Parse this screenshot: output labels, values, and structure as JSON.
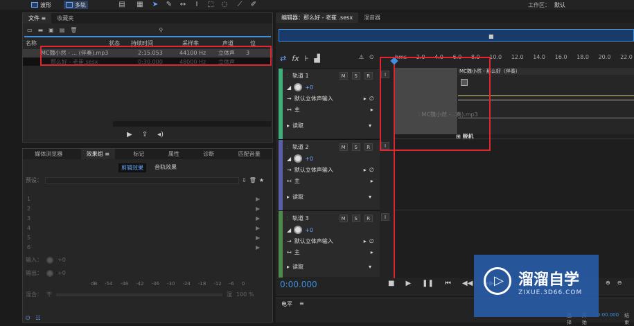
{
  "topbar": {
    "waveform_label": "波形",
    "multitrack_label": "多轨",
    "workspace_label": "工作区：",
    "workspace_value": "默认"
  },
  "files_panel": {
    "tabs": [
      "文件",
      "收藏夹"
    ],
    "columns": [
      "名称",
      "状态",
      "持续时间",
      "采样率",
      "声道",
      "位"
    ],
    "rows": [
      {
        "name": "MC魏小然 - ... (伴奏).mp3",
        "duration": "2:15.053",
        "rate": "44100 Hz",
        "channels": "立体声",
        "bits": "3"
      },
      {
        "name": "那么好 - 老崔.sesx",
        "duration": "0:30.000",
        "rate": "48000 Hz",
        "channels": "立体声",
        "bits": ""
      }
    ]
  },
  "effects_panel": {
    "tabs": [
      "媒体浏览器",
      "效果组",
      "标记",
      "属性",
      "诊断",
      "匹配音量"
    ],
    "subtabs": [
      "剪辑效果",
      "音轨效果"
    ],
    "preset_label": "预设：",
    "slots": [
      "1",
      "2",
      "3",
      "4",
      "5",
      "6"
    ],
    "input_label": "输入：",
    "input_value": "+0",
    "output_label": "输出：",
    "output_value": "+0",
    "meter_ticks": [
      "dB",
      "-54",
      "-48",
      "-42",
      "-36",
      "-30",
      "-24",
      "-18",
      "-12",
      "-6",
      "0"
    ],
    "mix_label": "混合：",
    "mix_left": "干",
    "mix_right": "湿",
    "mix_value": "100 %"
  },
  "editor": {
    "tabs": [
      "编辑器：那么好 - 老崔 .sesx",
      "混音器"
    ],
    "ruler": [
      "hms",
      "2.0",
      "4.0",
      "6.0",
      "8.0",
      "10.0",
      "12.0",
      "14.0",
      "16.0",
      "18.0",
      "20.0",
      "22.0"
    ],
    "clip_title": "MC魏小然 - 那么好（伴奏）",
    "drag_label": "MC魏小然 -...奏).mp3",
    "detach_label": "脱机",
    "tracks": [
      {
        "name": "轨道 1",
        "volume": "+0",
        "input": "默认立体声输入",
        "output": "主",
        "mode": "读取",
        "color": "#3fae7a"
      },
      {
        "name": "轨道 2",
        "volume": "+0",
        "input": "默认立体声输入",
        "output": "主",
        "mode": "读取",
        "color": "#5c5fa8"
      },
      {
        "name": "轨道 3",
        "volume": "+0",
        "input": "默认立体声输入",
        "output": "主",
        "mode": "读取",
        "color": "#4e8a4a"
      }
    ],
    "msr": [
      "M",
      "S",
      "R",
      "I"
    ],
    "timecode": "0:00.000",
    "level_label": "电平"
  },
  "bottom_right": {
    "start_label": "开始",
    "end_label": "结束",
    "select_label": "选择",
    "start_value": "0:00.000"
  },
  "watermark": {
    "title": "溜溜自学",
    "url": "ZIXUE.3D66.COM"
  },
  "colors": {
    "accent": "#3f8fe0",
    "red": "#e2262f",
    "track1": "#3fae7a",
    "track2": "#5c5fa8",
    "track3": "#4e8a4a"
  }
}
